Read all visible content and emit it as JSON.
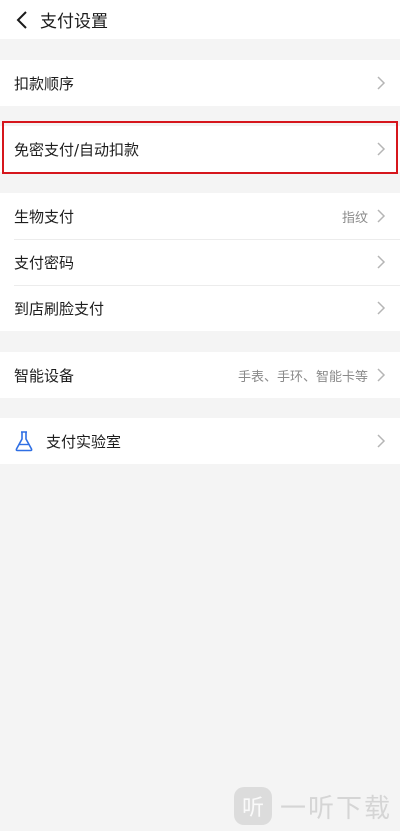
{
  "header": {
    "title": "支付设置"
  },
  "groups": {
    "order": {
      "label": "扣款顺序"
    },
    "auto_pay": {
      "label": "免密支付/自动扣款"
    },
    "bio": {
      "label": "生物支付",
      "value": "指纹"
    },
    "password": {
      "label": "支付密码"
    },
    "face_pay": {
      "label": "到店刷脸支付"
    },
    "devices": {
      "label": "智能设备",
      "value": "手表、手环、智能卡等"
    },
    "lab": {
      "label": "支付实验室"
    }
  },
  "highlight_color": "#d6161c",
  "lab_icon_color": "#2f6fe4",
  "watermark": {
    "logo_char": "听",
    "text": "一听下载"
  }
}
